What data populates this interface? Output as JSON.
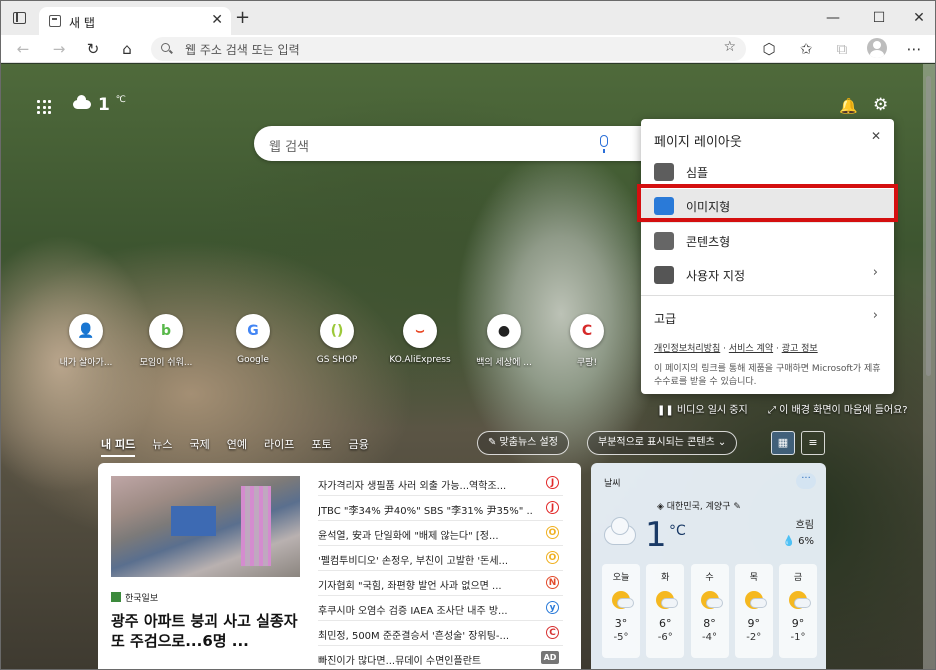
{
  "tab": {
    "title": "새 탭",
    "close": "✕",
    "new_tab": "+"
  },
  "window": {
    "minimize": "—",
    "maximize": "☐",
    "close": "✕"
  },
  "nav": {
    "back": "←",
    "forward": "→",
    "refresh": "↻",
    "home": "⌂",
    "address_placeholder": "웹 주소 검색 또는 입력",
    "favorite": "☆",
    "ext": "⬡",
    "favorites": "✩",
    "collections": "⧉",
    "more": "⋯"
  },
  "top": {
    "temp": "1",
    "unit": "℃",
    "bell": "🔔",
    "gear": "⚙"
  },
  "search": {
    "placeholder": "웹 검색"
  },
  "quick_links": [
    {
      "label": "내가 살아가...",
      "glyph": "👤",
      "color": "#c9a070"
    },
    {
      "label": "모임이 쉬워...",
      "glyph": "b",
      "color": "#58b84a"
    },
    {
      "label": "Google",
      "glyph": "G",
      "color": "#4285f4"
    },
    {
      "label": "GS SHOP",
      "glyph": "()",
      "color": "#9cc83a"
    },
    {
      "label": "KO.AliExpress",
      "glyph": "⌣",
      "color": "#e8431f"
    },
    {
      "label": "백의 세상에 ...",
      "glyph": "●",
      "color": "#222222"
    },
    {
      "label": "쿠팡!",
      "glyph": "C",
      "color": "#d62a2a"
    }
  ],
  "flyout": {
    "title": "페이지 레이아웃",
    "close": "✕",
    "options": [
      {
        "label": "심플"
      },
      {
        "label": "이미지형"
      },
      {
        "label": "콘텐츠형"
      },
      {
        "label": "사용자 지정",
        "chevron": "›"
      }
    ],
    "advanced": {
      "label": "고급",
      "chevron": "›"
    },
    "links": [
      "개인정보처리방침",
      "서비스 계약",
      "광고 정보"
    ],
    "disclaimer": "이 페이지의 링크를 통해 제품을 구매하면 Microsoft가 제휴 수수료를 받을 수 있습니다."
  },
  "video_pause": "❚❚  비디오 일시 중지",
  "bg_info": "⤢  이 배경 화면이 마음에 들어요?",
  "feed_tabs": [
    "내 피드",
    "뉴스",
    "국제",
    "연예",
    "라이프",
    "포토",
    "금융"
  ],
  "personalize": "✎ 맞춤뉴스 설정",
  "content_toggle": "부분적으로 표시되는 콘텐츠 ⌄",
  "news": {
    "source": "한국일보",
    "headline": "광주 아파트 붕괴 사고 실종자 또 주검으로...6명 ...",
    "items": [
      {
        "title": "자가격리자 생필품 사러 외출 가능...역학조...",
        "pub": "J",
        "color": "#e22828"
      },
      {
        "title": "JTBC \"李34% 尹40%\" SBS \"李31% 尹35%\" ...",
        "pub": "J",
        "color": "#e22828"
      },
      {
        "title": "윤석열, 安과 단일화에 \"배제 않는다\" [정...",
        "pub": "O",
        "color": "#f0b020"
      },
      {
        "title": "'펠컴투비디오' 손정우, 부친이 고발한 '돈세...",
        "pub": "O",
        "color": "#f0b020"
      },
      {
        "title": "기자협회 \"국힘, 좌편향 발언 사과 없으면 ...",
        "pub": "N",
        "color": "#e24a2a"
      },
      {
        "title": "후쿠시마 오염수 검증 IAEA 조사단 내주 방...",
        "pub": "y",
        "color": "#2a7ad8"
      },
      {
        "title": "최민정, 500M 준준결승서 '흔성술' 장위팅-...",
        "pub": "C",
        "color": "#d63030"
      },
      {
        "title": "빠진이가 많다면...뮤데이 수면인플란트",
        "pub": "AD",
        "color": "#555555"
      }
    ]
  },
  "weather": {
    "title": "날씨",
    "more": "···",
    "location": "◈ 대한민국, 계양구 ✎",
    "temp": "1",
    "unit": "°C",
    "condition": "흐림",
    "precip": "💧 6%",
    "days": [
      {
        "day": "오늘",
        "hi": "3°",
        "lo": "-5°"
      },
      {
        "day": "화",
        "hi": "6°",
        "lo": "-6°"
      },
      {
        "day": "수",
        "hi": "8°",
        "lo": "-4°"
      },
      {
        "day": "목",
        "hi": "9°",
        "lo": "-2°"
      },
      {
        "day": "금",
        "hi": "9°",
        "lo": "-1°"
      }
    ]
  }
}
